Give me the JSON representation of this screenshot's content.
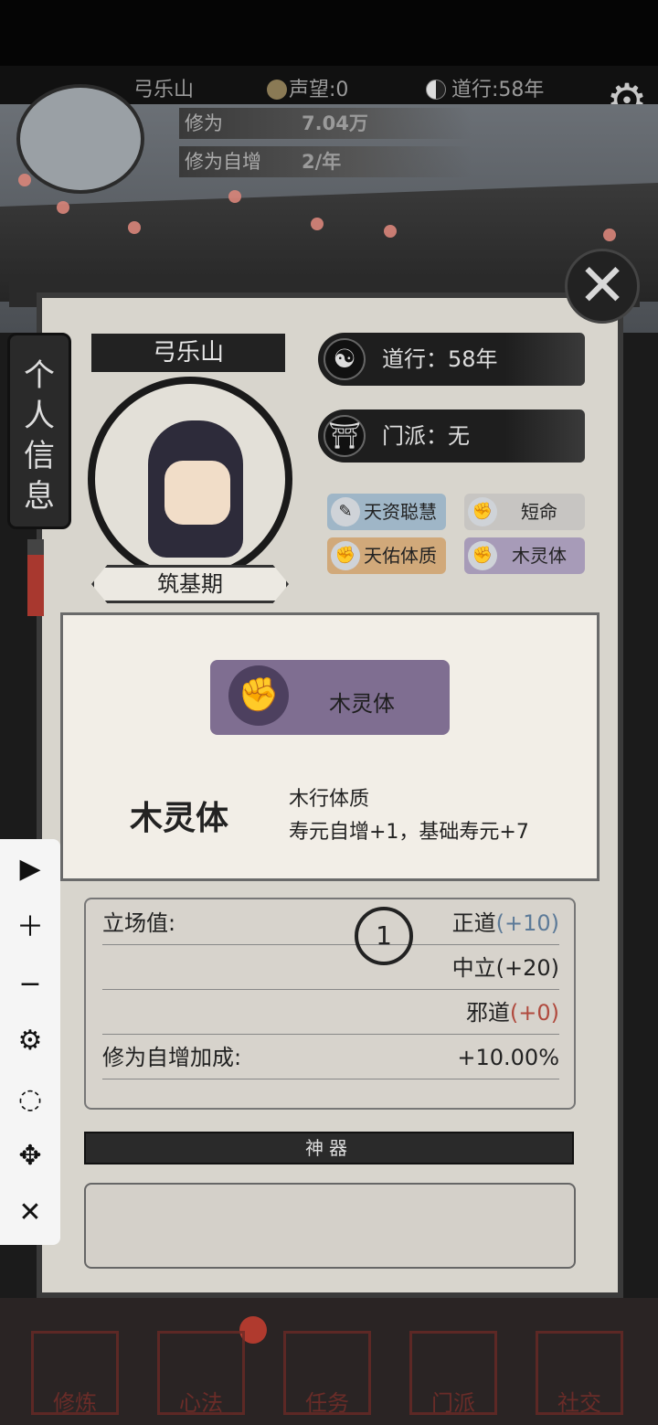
{
  "topbar": {
    "player_name": "弓乐山",
    "reputation_label": "声望:0",
    "dao_label": "道行:58年"
  },
  "top_stats": {
    "cultivation_label": "修为",
    "cultivation_value": "7.04万",
    "auto_label": "修为自增",
    "auto_value": "2/年"
  },
  "side_tab": {
    "label": "个人信息"
  },
  "profile": {
    "name": "弓乐山",
    "realm": "筑基期",
    "dao": "道行：58年",
    "sect": "门派：无"
  },
  "traits": [
    {
      "label": "天资聪慧"
    },
    {
      "label": "短命"
    },
    {
      "label": "天佑体质"
    },
    {
      "label": "木灵体"
    }
  ],
  "detail": {
    "banner": "木灵体",
    "name": "木灵体",
    "desc1": "木行体质",
    "desc2": "寿元自增+1，基础寿元+7"
  },
  "stats": {
    "stance_label": "立场值:",
    "righteous": "正道",
    "righteous_val": "(+10)",
    "neutral": "中立(+20)",
    "evil": "邪道",
    "evil_val": "(+0)",
    "cult_bonus_label": "修为自增加成:",
    "cult_bonus_val": "+10.00%",
    "crosshair": "1"
  },
  "artifact": {
    "title": "神器"
  },
  "nav": [
    {
      "label": "修炼"
    },
    {
      "label": "心法"
    },
    {
      "label": "任务"
    },
    {
      "label": "门派"
    },
    {
      "label": "社交"
    }
  ],
  "colors": {
    "righteous": "#5c7a98",
    "evil": "#b04a3e"
  }
}
